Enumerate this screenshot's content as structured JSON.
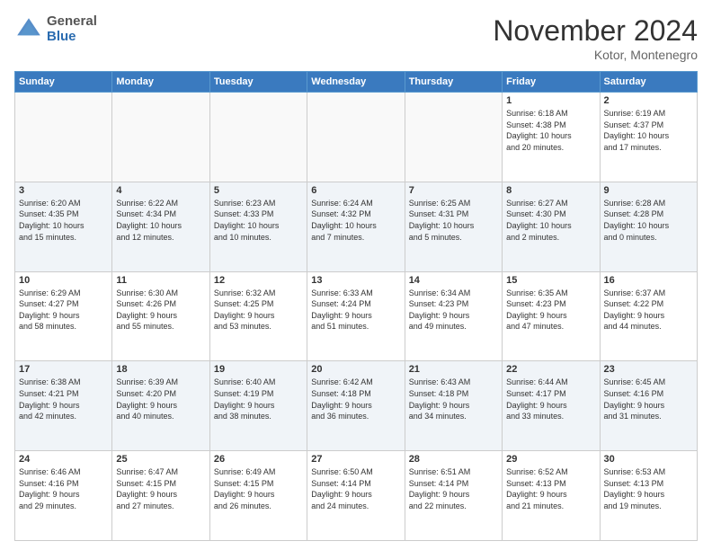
{
  "logo": {
    "general": "General",
    "blue": "Blue"
  },
  "title": "November 2024",
  "location": "Kotor, Montenegro",
  "days_of_week": [
    "Sunday",
    "Monday",
    "Tuesday",
    "Wednesday",
    "Thursday",
    "Friday",
    "Saturday"
  ],
  "weeks": [
    [
      {
        "day": "",
        "info": ""
      },
      {
        "day": "",
        "info": ""
      },
      {
        "day": "",
        "info": ""
      },
      {
        "day": "",
        "info": ""
      },
      {
        "day": "",
        "info": ""
      },
      {
        "day": "1",
        "info": "Sunrise: 6:18 AM\nSunset: 4:38 PM\nDaylight: 10 hours\nand 20 minutes."
      },
      {
        "day": "2",
        "info": "Sunrise: 6:19 AM\nSunset: 4:37 PM\nDaylight: 10 hours\nand 17 minutes."
      }
    ],
    [
      {
        "day": "3",
        "info": "Sunrise: 6:20 AM\nSunset: 4:35 PM\nDaylight: 10 hours\nand 15 minutes."
      },
      {
        "day": "4",
        "info": "Sunrise: 6:22 AM\nSunset: 4:34 PM\nDaylight: 10 hours\nand 12 minutes."
      },
      {
        "day": "5",
        "info": "Sunrise: 6:23 AM\nSunset: 4:33 PM\nDaylight: 10 hours\nand 10 minutes."
      },
      {
        "day": "6",
        "info": "Sunrise: 6:24 AM\nSunset: 4:32 PM\nDaylight: 10 hours\nand 7 minutes."
      },
      {
        "day": "7",
        "info": "Sunrise: 6:25 AM\nSunset: 4:31 PM\nDaylight: 10 hours\nand 5 minutes."
      },
      {
        "day": "8",
        "info": "Sunrise: 6:27 AM\nSunset: 4:30 PM\nDaylight: 10 hours\nand 2 minutes."
      },
      {
        "day": "9",
        "info": "Sunrise: 6:28 AM\nSunset: 4:28 PM\nDaylight: 10 hours\nand 0 minutes."
      }
    ],
    [
      {
        "day": "10",
        "info": "Sunrise: 6:29 AM\nSunset: 4:27 PM\nDaylight: 9 hours\nand 58 minutes."
      },
      {
        "day": "11",
        "info": "Sunrise: 6:30 AM\nSunset: 4:26 PM\nDaylight: 9 hours\nand 55 minutes."
      },
      {
        "day": "12",
        "info": "Sunrise: 6:32 AM\nSunset: 4:25 PM\nDaylight: 9 hours\nand 53 minutes."
      },
      {
        "day": "13",
        "info": "Sunrise: 6:33 AM\nSunset: 4:24 PM\nDaylight: 9 hours\nand 51 minutes."
      },
      {
        "day": "14",
        "info": "Sunrise: 6:34 AM\nSunset: 4:23 PM\nDaylight: 9 hours\nand 49 minutes."
      },
      {
        "day": "15",
        "info": "Sunrise: 6:35 AM\nSunset: 4:23 PM\nDaylight: 9 hours\nand 47 minutes."
      },
      {
        "day": "16",
        "info": "Sunrise: 6:37 AM\nSunset: 4:22 PM\nDaylight: 9 hours\nand 44 minutes."
      }
    ],
    [
      {
        "day": "17",
        "info": "Sunrise: 6:38 AM\nSunset: 4:21 PM\nDaylight: 9 hours\nand 42 minutes."
      },
      {
        "day": "18",
        "info": "Sunrise: 6:39 AM\nSunset: 4:20 PM\nDaylight: 9 hours\nand 40 minutes."
      },
      {
        "day": "19",
        "info": "Sunrise: 6:40 AM\nSunset: 4:19 PM\nDaylight: 9 hours\nand 38 minutes."
      },
      {
        "day": "20",
        "info": "Sunrise: 6:42 AM\nSunset: 4:18 PM\nDaylight: 9 hours\nand 36 minutes."
      },
      {
        "day": "21",
        "info": "Sunrise: 6:43 AM\nSunset: 4:18 PM\nDaylight: 9 hours\nand 34 minutes."
      },
      {
        "day": "22",
        "info": "Sunrise: 6:44 AM\nSunset: 4:17 PM\nDaylight: 9 hours\nand 33 minutes."
      },
      {
        "day": "23",
        "info": "Sunrise: 6:45 AM\nSunset: 4:16 PM\nDaylight: 9 hours\nand 31 minutes."
      }
    ],
    [
      {
        "day": "24",
        "info": "Sunrise: 6:46 AM\nSunset: 4:16 PM\nDaylight: 9 hours\nand 29 minutes."
      },
      {
        "day": "25",
        "info": "Sunrise: 6:47 AM\nSunset: 4:15 PM\nDaylight: 9 hours\nand 27 minutes."
      },
      {
        "day": "26",
        "info": "Sunrise: 6:49 AM\nSunset: 4:15 PM\nDaylight: 9 hours\nand 26 minutes."
      },
      {
        "day": "27",
        "info": "Sunrise: 6:50 AM\nSunset: 4:14 PM\nDaylight: 9 hours\nand 24 minutes."
      },
      {
        "day": "28",
        "info": "Sunrise: 6:51 AM\nSunset: 4:14 PM\nDaylight: 9 hours\nand 22 minutes."
      },
      {
        "day": "29",
        "info": "Sunrise: 6:52 AM\nSunset: 4:13 PM\nDaylight: 9 hours\nand 21 minutes."
      },
      {
        "day": "30",
        "info": "Sunrise: 6:53 AM\nSunset: 4:13 PM\nDaylight: 9 hours\nand 19 minutes."
      }
    ]
  ]
}
